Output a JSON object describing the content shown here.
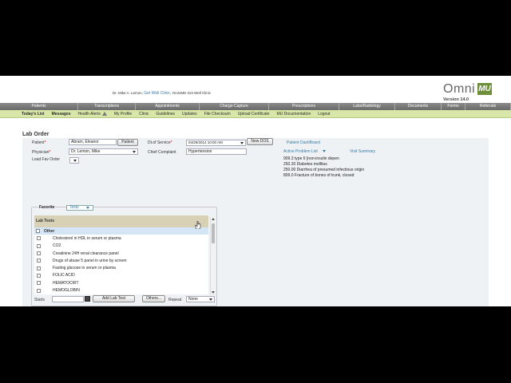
{
  "header": {
    "provider_text": "Dr. Mike A. Lemon,",
    "clinic_link": "Get Well Clinic,",
    "org_text": "OmniMD Get Well Clinic",
    "logo_text": "Omni",
    "logo_badge": "MU",
    "version": "Version 14.0"
  },
  "main_nav": [
    {
      "label": "Patients"
    },
    {
      "label": "Transcriptions"
    },
    {
      "label": "Appointments"
    },
    {
      "label": "Charge Capture"
    },
    {
      "label": "Prescriptions"
    },
    {
      "label": "Labs/Radiology"
    },
    {
      "label": "Documents"
    },
    {
      "label": "Forms"
    },
    {
      "label": "Referrals"
    }
  ],
  "sub_nav": [
    {
      "label": "Today's List"
    },
    {
      "label": "Messages"
    },
    {
      "label": "Health Alerts"
    },
    {
      "label": "My Profile"
    },
    {
      "label": "Clinic"
    },
    {
      "label": "Guidelines"
    },
    {
      "label": "Updates"
    },
    {
      "label": "File Checksum"
    },
    {
      "label": "Upload Certificate"
    },
    {
      "label": "MU Documentation"
    },
    {
      "label": "Logout"
    }
  ],
  "page": {
    "title": "Lab Order"
  },
  "form": {
    "patient_label": "Patient",
    "patient_value": "Abram, Eleanor",
    "patient_button": "Patient",
    "dos_label": "Dt.of Service",
    "dos_value": "04/29/2014 10:00 AM",
    "new_dos_button": "New DOS",
    "dashboard_link": "Patient DashBoard",
    "physician_label": "Physician",
    "physician_value": "Dr. Lemon, Mike",
    "complaint_label": "Chief Complaint",
    "complaint_value": "Hypertension",
    "active_problem_link": "Active Problem List",
    "visit_summary_link": "Visit Summary",
    "load_fav_label": "Load Fav Order",
    "required_mark": "*",
    "problems": [
      "909.3 type II [non-insulin depen",
      "250.20 Diabetes mellitus",
      "250.00 Diarrhea of presumed infectious origin",
      "809.0 Fracture of bones of trunk, closed"
    ]
  },
  "tests": {
    "favorite_label": "Favorite",
    "dropdown_value": "Tests",
    "header": "Lab Tests",
    "group": "Other",
    "items": [
      "Cholesterol in HDL in serum or plasma",
      "CO2",
      "Creatinine 24H renal clearance panel",
      "Drugs of abuse 5 panel in urine by screen",
      "Fasting glucose in serum or plasma",
      "FOLIC ACID",
      "HEMATOCRIT",
      "HEMOGLOBIN"
    ],
    "starts_label": "Starts",
    "add_button": "Add Lab Test",
    "others_button": "Others...",
    "repeat_label": "Repeat",
    "repeat_value": "None"
  }
}
